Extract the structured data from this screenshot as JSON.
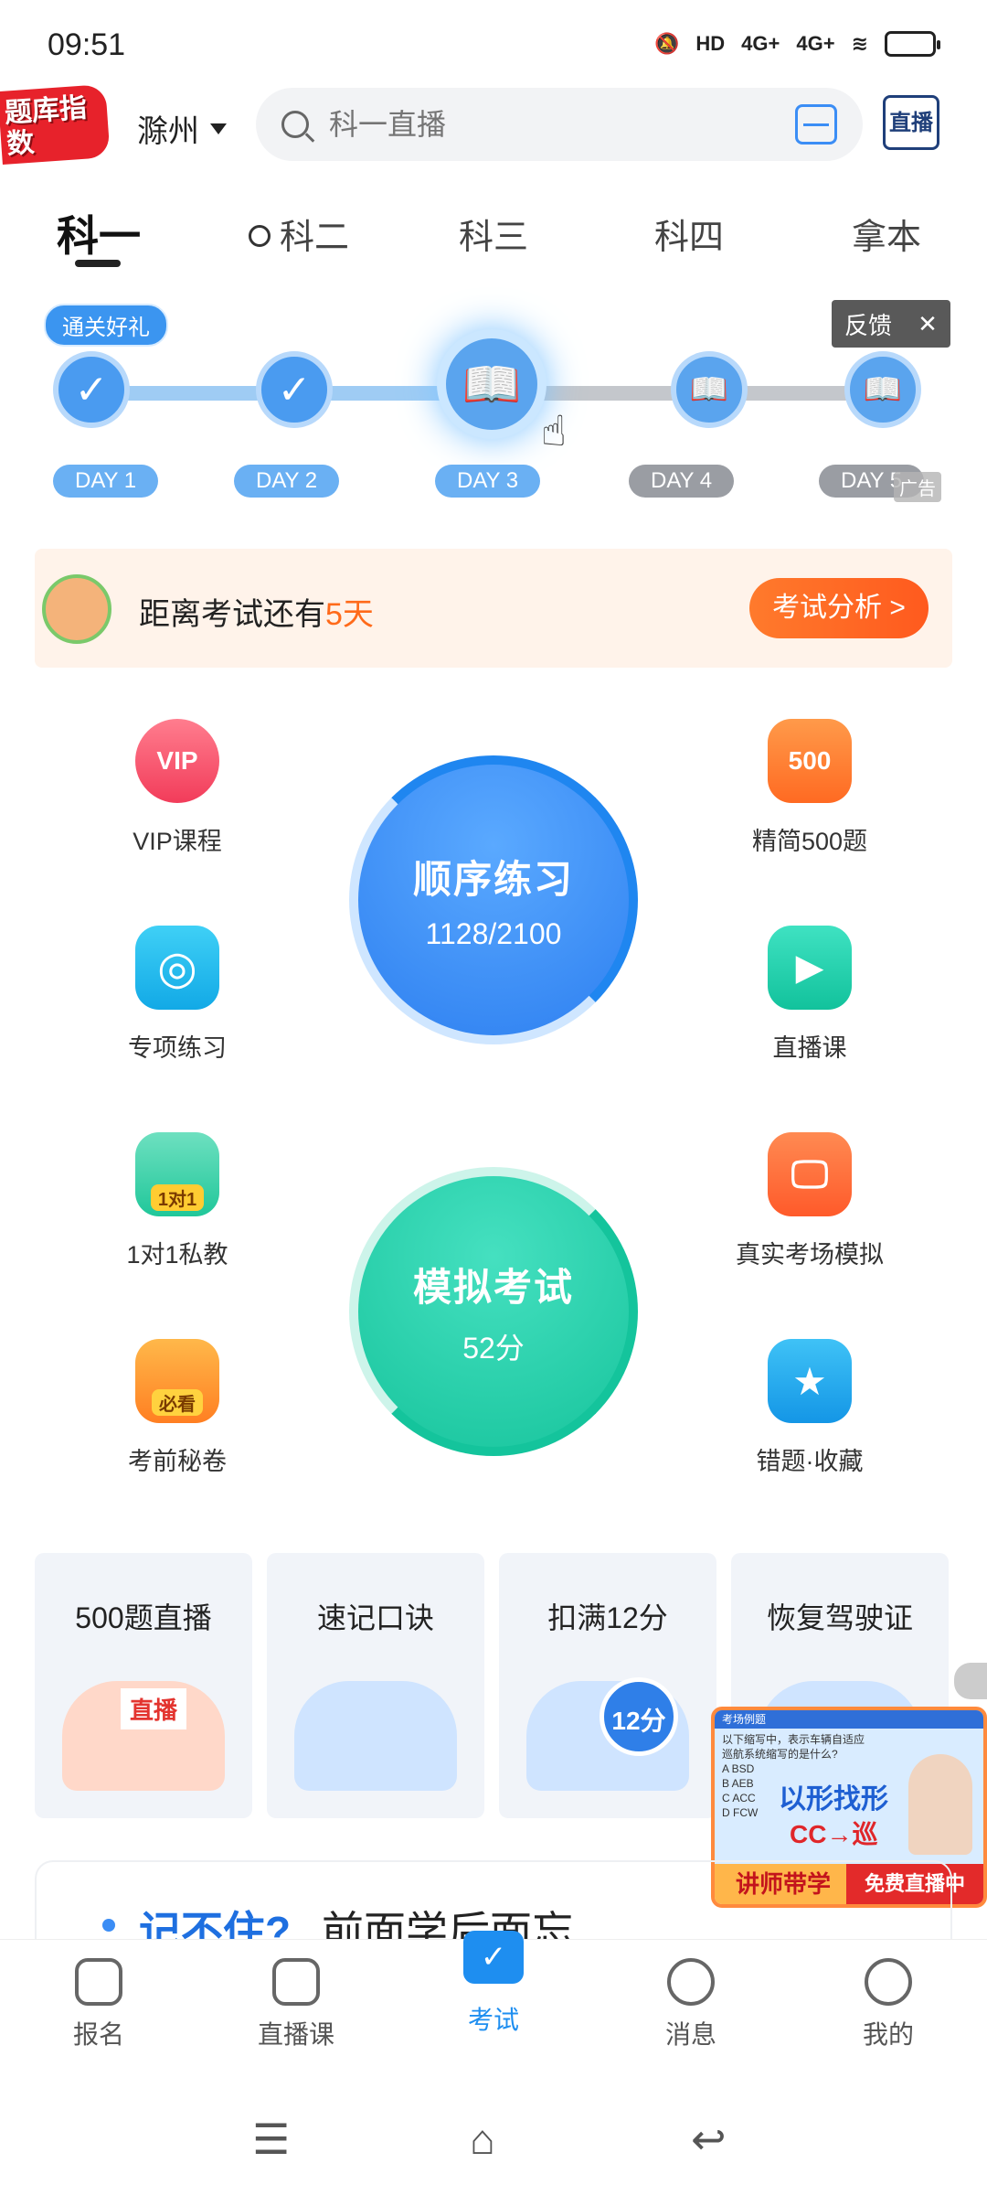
{
  "status_bar": {
    "time": "09:51",
    "network_1": "4G+",
    "network_2": "4G+",
    "hd": "HD"
  },
  "header": {
    "logo_text": "题库指数",
    "city": "滁州",
    "search_placeholder": "科一直播",
    "live_label": "直播"
  },
  "tabs": [
    {
      "label": "科一"
    },
    {
      "label": "科二"
    },
    {
      "label": "科三"
    },
    {
      "label": "科四"
    },
    {
      "label": "拿本"
    }
  ],
  "banner": {
    "gift_tag": "通关好礼",
    "feedback": "反馈",
    "ad": "广告",
    "days": [
      "DAY 1",
      "DAY 2",
      "DAY 3",
      "DAY 4",
      "DAY 5"
    ]
  },
  "countdown": {
    "prefix": "距离考试还有",
    "days": "5天",
    "button": "考试分析 >"
  },
  "features": {
    "vip": "VIP课程",
    "jingjian": "精简500题",
    "zhuanxiang": "专项练习",
    "zhibo": "直播课",
    "private": "1对1私教",
    "private_badge": "1对1",
    "real_exam": "真实考场模拟",
    "secret": "考前秘卷",
    "secret_badge": "必看",
    "wrong": "错题·收藏",
    "vip_badge": "VIP",
    "jingjian_badge": "500"
  },
  "practice": {
    "title": "顺序练习",
    "progress": "1128/2100",
    "progress_fraction": 0.537
  },
  "mock_exam": {
    "title": "模拟考试",
    "score": "52分"
  },
  "cards": [
    {
      "title": "500题直播",
      "badge": "直播"
    },
    {
      "title": "速记口诀"
    },
    {
      "title": "扣满12分",
      "badge": "12分"
    },
    {
      "title": "恢复驾驶证"
    }
  ],
  "float_live": {
    "header": "考场例题",
    "question": "以下缩写中，表示车辆自适应巡航系统缩写的是什么?",
    "options": [
      "A BSD",
      "B AEB",
      "C ACC",
      "D FCW"
    ],
    "headline": "以形找形",
    "formula": "CC→巡",
    "footer_left": "讲师带学",
    "footer_right": "免费直播中"
  },
  "memo": {
    "highlight": "记不住?",
    "text": "前面学后面忘"
  },
  "bottom_nav": [
    {
      "label": "报名"
    },
    {
      "label": "直播课"
    },
    {
      "label": "考试"
    },
    {
      "label": "消息"
    },
    {
      "label": "我的"
    }
  ],
  "colors": {
    "accent": "#1e8ef0",
    "orange": "#ff6a1a",
    "teal": "#1fcaa4",
    "brand_red": "#e7222b"
  }
}
